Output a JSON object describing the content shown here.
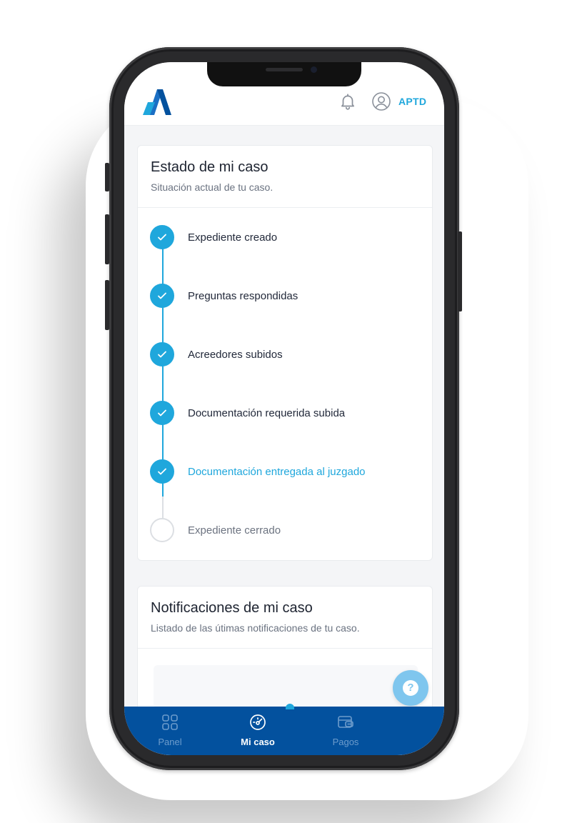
{
  "header": {
    "user_name": "APTD",
    "icons": {
      "logo": "brand-a-logo",
      "bell": "bell-icon",
      "user": "user-circle-icon"
    }
  },
  "status_card": {
    "title": "Estado de mi caso",
    "subtitle": "Situación actual de tu caso.",
    "steps": [
      {
        "label": "Expediente creado",
        "state": "done"
      },
      {
        "label": "Preguntas respondidas",
        "state": "done"
      },
      {
        "label": "Acreedores subidos",
        "state": "done"
      },
      {
        "label": "Documentación requerida subida",
        "state": "done"
      },
      {
        "label": "Documentación entregada al juzgado",
        "state": "current"
      },
      {
        "label": "Expediente cerrado",
        "state": "pending"
      }
    ]
  },
  "notifications_card": {
    "title": "Notificaciones de mi caso",
    "subtitle": "Listado de las útimas notificaciones de tu caso."
  },
  "help_button": {
    "label": "?"
  },
  "bottom_nav": {
    "items": [
      {
        "label": "Panel",
        "icon": "grid-icon",
        "active": false
      },
      {
        "label": "Mi caso",
        "icon": "gauge-icon",
        "active": true
      },
      {
        "label": "Pagos",
        "icon": "wallet-icon",
        "active": false
      }
    ]
  },
  "colors": {
    "accent": "#1fa7dc",
    "nav_background": "#03519e",
    "text_dark": "#1d2330",
    "pending_circle": "#dcdfe3"
  }
}
